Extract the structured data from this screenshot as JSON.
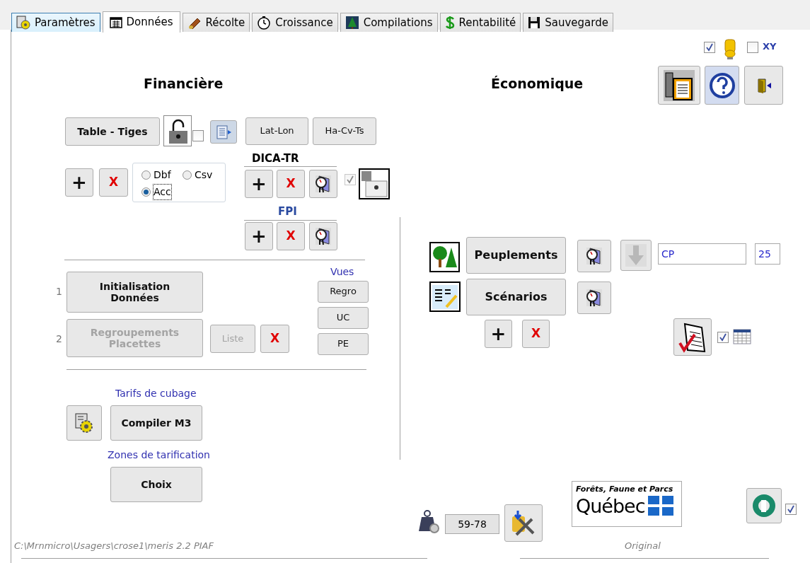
{
  "tabs": [
    {
      "label": "Paramètres",
      "selected": false
    },
    {
      "label": "Données",
      "selected": true
    },
    {
      "label": "Récolte",
      "selected": false
    },
    {
      "label": "Croissance",
      "selected": false
    },
    {
      "label": "Compilations",
      "selected": false
    },
    {
      "label": "Rentabilité",
      "selected": false
    },
    {
      "label": "Sauvegarde",
      "selected": false
    }
  ],
  "top_options": {
    "database_checked": true,
    "xy": {
      "label": "XY",
      "checked": false
    }
  },
  "financiere": {
    "title": "Financière",
    "table_button": "Table - Tiges",
    "lock_checked": false,
    "latlon_button": "Lat-Lon",
    "hacvts_button": "Ha-Cv-Ts",
    "add": "+",
    "remove": "X",
    "formats": [
      {
        "label": "Dbf",
        "selected": false
      },
      {
        "label": "Csv",
        "selected": false
      },
      {
        "label": "Acc",
        "selected": true
      }
    ],
    "dica": {
      "title": "DICA-TR",
      "add": "+",
      "remove": "X",
      "checked": true,
      "disabled": true
    },
    "fpi": {
      "title": "FPI",
      "add": "+",
      "remove": "X"
    },
    "steps": [
      {
        "number": "1",
        "label": "Initialisation Données",
        "disabled": false
      },
      {
        "number": "2",
        "label": "Regroupements Placettes",
        "disabled": true
      }
    ],
    "liste": {
      "label": "Liste",
      "disabled": true
    },
    "step_remove": "X",
    "vues": {
      "title": "Vues",
      "buttons": [
        "Regro",
        "UC",
        "PE"
      ]
    },
    "tarifs_label": "Tarifs de cubage",
    "compiler_button": "Compiler M3",
    "zones_label": "Zones de tarification",
    "choix_button": "Choix"
  },
  "economique": {
    "title": "Économique",
    "peuplements_button": "Peuplements",
    "scenarios_button": "Scénarios",
    "code": "CP",
    "number": "25",
    "add": "+",
    "remove": "X",
    "report_checked": true
  },
  "footer": {
    "path": "C:\\Mrnmicro\\Usagers\\crose1\\meris 2.2 PIAF",
    "range": "59-78",
    "logo_line1": "Forêts, Faune et Parcs",
    "logo_line2": "Québec",
    "logo_caption": "Original",
    "bottom_checked": true
  }
}
